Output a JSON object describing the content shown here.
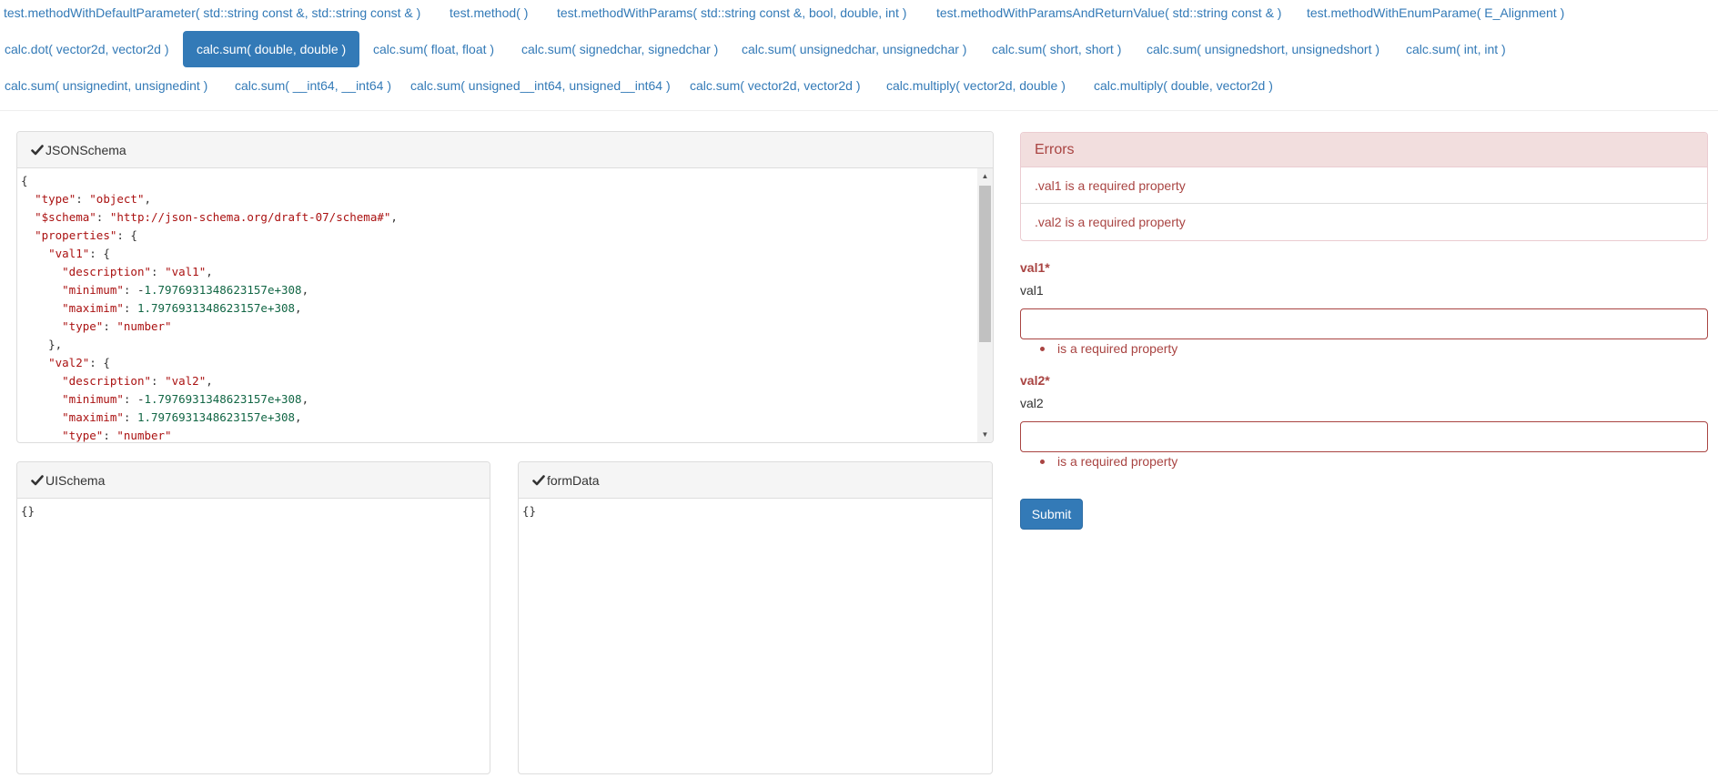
{
  "nav": {
    "row0": [
      "test.methodWithDefaultParameter( std::string const &, std::string const & )",
      "test.method( )",
      "test.methodWithParams( std::string const &, bool, double, int )",
      "test.methodWithParamsAndReturnValue( std::string const & )",
      "test.methodWithEnumParame( E_Alignment )"
    ],
    "row1": [
      "calc.dot( vector2d, vector2d )",
      "calc.sum( double, double )",
      "calc.sum( float, float )",
      "calc.sum( signedchar, signedchar )",
      "calc.sum( unsignedchar, unsignedchar )",
      "calc.sum( short, short )",
      "calc.sum( unsignedshort, unsignedshort )",
      "calc.sum( int, int )"
    ],
    "row2": [
      "calc.sum( unsignedint, unsignedint )",
      "calc.sum( __int64, __int64 )",
      "calc.sum( unsigned__int64, unsigned__int64 )",
      "calc.sum( vector2d, vector2d )",
      "calc.multiply( vector2d, double )",
      "calc.multiply( double, vector2d )"
    ],
    "active": "calc.sum( double, double )"
  },
  "editors": {
    "json_schema": {
      "title": "JSONSchema",
      "lines": [
        "{",
        "  \"type\": \"object\",",
        "  \"$schema\": \"http://json-schema.org/draft-07/schema#\",",
        "  \"properties\": {",
        "    \"val1\": {",
        "      \"description\": \"val1\",",
        "      \"minimum\": -1.7976931348623157e+308,",
        "      \"maximim\": 1.7976931348623157e+308,",
        "      \"type\": \"number\"",
        "    },",
        "    \"val2\": {",
        "      \"description\": \"val2\",",
        "      \"minimum\": -1.7976931348623157e+308,",
        "      \"maximim\": 1.7976931348623157e+308,",
        "      \"type\": \"number\""
      ]
    },
    "ui_schema": {
      "title": "UISchema",
      "content": "{}"
    },
    "form_data": {
      "title": "formData",
      "content": "{}"
    }
  },
  "errors": {
    "title": "Errors",
    "items": [
      ".val1 is a required property",
      ".val2 is a required property"
    ]
  },
  "form": {
    "fields": [
      {
        "label": "val1*",
        "description": "val1",
        "value": "",
        "error": "is a required property"
      },
      {
        "label": "val2*",
        "description": "val2",
        "value": "",
        "error": "is a required property"
      }
    ],
    "submit_label": "Submit"
  },
  "colors": {
    "link": "#337ab7",
    "active_bg": "#337ab7",
    "error": "#a94442",
    "error_bg": "#f2dede",
    "panel_heading_bg": "#f5f5f5"
  },
  "icons": {
    "panel_check": "check-icon"
  }
}
